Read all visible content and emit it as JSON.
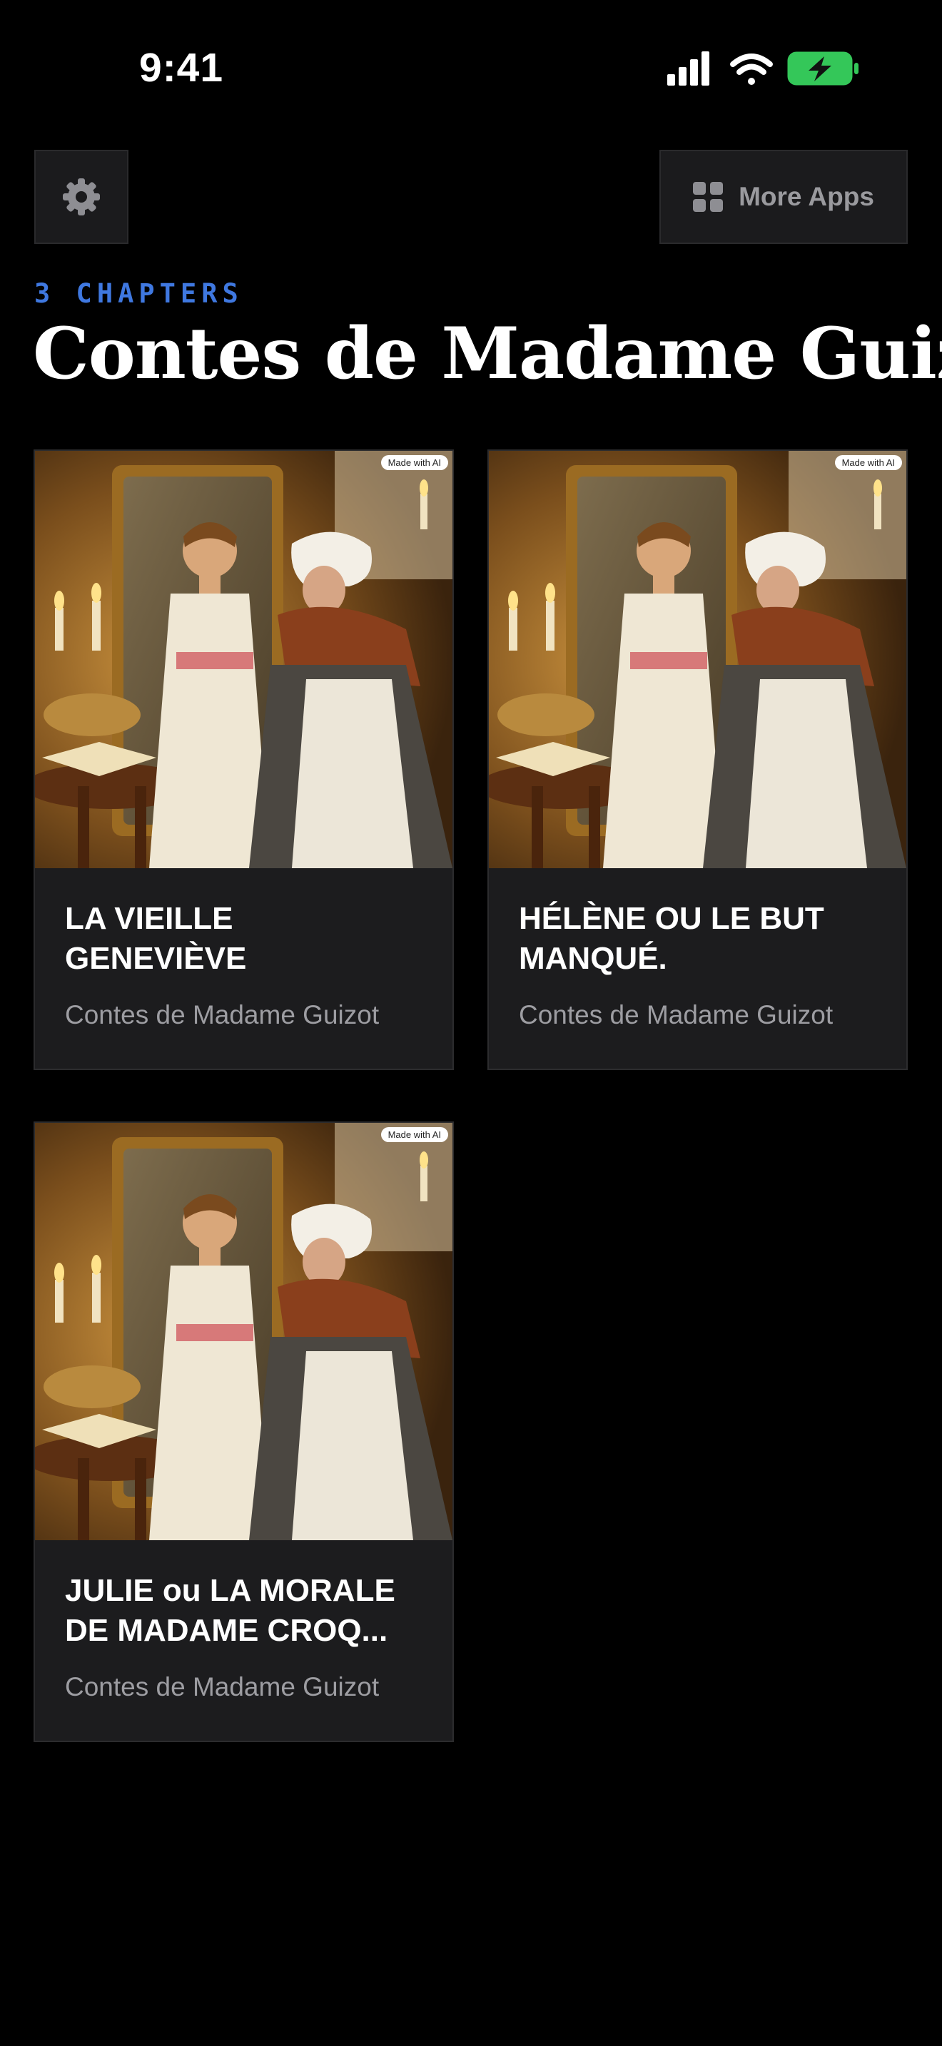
{
  "status_bar": {
    "time": "9:41",
    "icons": [
      "cellular-signal-icon",
      "wifi-icon",
      "battery-charging-icon"
    ],
    "battery_color": "#34c759"
  },
  "header": {
    "settings_icon": "gear-icon",
    "more_apps_icon": "grid-icon",
    "more_apps_label": "More Apps"
  },
  "collection": {
    "chapters_label": "3 CHAPTERS",
    "title": "Contes de Madame Guizot",
    "accent_color": "#3f78e0"
  },
  "chapters": [
    {
      "title": "LA VIEILLE GENEVIÈVE",
      "subtitle": "Contes de Madame Guizot",
      "badge": "Made with AI"
    },
    {
      "title": "HÉLÈNE OU LE BUT MANQUÉ.",
      "subtitle": "Contes de Madame Guizot",
      "badge": "Made with AI"
    },
    {
      "title": "JULIE ou LA MORALE DE MADAME CROQ...",
      "subtitle": "Contes de Madame Guizot",
      "badge": "Made with AI"
    }
  ]
}
